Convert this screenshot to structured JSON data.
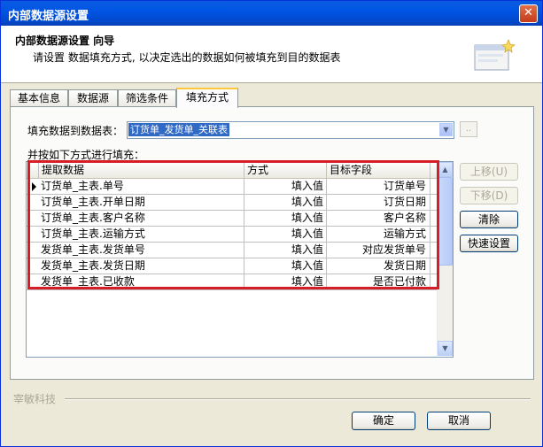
{
  "window": {
    "title": "内部数据源设置"
  },
  "header": {
    "title": "内部数据源设置  向导",
    "description": "请设置 数据填充方式, 以决定选出的数据如何被填充到目的数据表"
  },
  "tabs": [
    {
      "label": "基本信息",
      "active": false
    },
    {
      "label": "数据源",
      "active": false
    },
    {
      "label": "筛选条件",
      "active": false
    },
    {
      "label": "填充方式",
      "active": true
    }
  ],
  "fill": {
    "table_label": "填充数据到数据表：",
    "table_value": "订货单_发货单_关联表",
    "browse_label": "..",
    "method_label": "并按如下方式进行填充："
  },
  "grid": {
    "columns": [
      "提取数据",
      "方式",
      "目标字段"
    ],
    "rows": [
      {
        "source": "订货单_主表.单号",
        "mode": "填入值",
        "target": "订货单号"
      },
      {
        "source": "订货单_主表.开单日期",
        "mode": "填入值",
        "target": "订货日期"
      },
      {
        "source": "订货单_主表.客户名称",
        "mode": "填入值",
        "target": "客户名称"
      },
      {
        "source": "订货单_主表.运输方式",
        "mode": "填入值",
        "target": "运输方式"
      },
      {
        "source": "发货单_主表.发货单号",
        "mode": "填入值",
        "target": "对应发货单号"
      },
      {
        "source": "发货单_主表.发货日期",
        "mode": "填入值",
        "target": "发货日期"
      },
      {
        "source": "发货单_主表.已收款",
        "mode": "填入值",
        "target": "是否已付款"
      }
    ]
  },
  "side_buttons": {
    "move_up": "上移(U)",
    "move_down": "下移(D)",
    "clear": "清除",
    "quick": "快速设置"
  },
  "footer": {
    "brand": "宰敏科技",
    "ok": "确定",
    "cancel": "取消"
  },
  "colors": {
    "highlight": "#d41e28",
    "selection": "#316ac5",
    "titlebar": "#0055e5"
  }
}
